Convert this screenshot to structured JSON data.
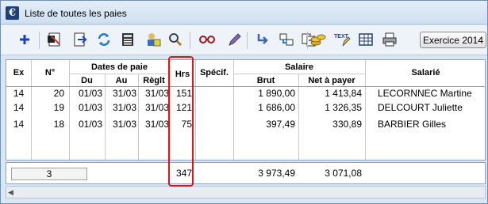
{
  "window": {
    "title": "Liste de toutes les paies"
  },
  "toolbar": {
    "exercice_label": "Exercice 2014",
    "icons": [
      "add-icon",
      "edit-doc-icon",
      "export-icon",
      "refresh-icon",
      "calculator-icon",
      "user-money-icon",
      "search-icon",
      "glasses-icon",
      "pencil-icon",
      "transfer-icon",
      "flow-icon",
      "coins-icon",
      "text-icon",
      "table-icon",
      "printer-icon"
    ],
    "text_icon_label": "TEXT"
  },
  "grid": {
    "headers": {
      "ex": "Ex",
      "num": "N°",
      "dates_group": "Dates de paie",
      "du": "Du",
      "au": "Au",
      "reglt": "Règlt",
      "hrs": "Hrs",
      "specif": "Spécif.",
      "salaire_group": "Salaire",
      "brut": "Brut",
      "net": "Net à payer",
      "salarie": "Salarié"
    },
    "rows": [
      {
        "ex": "14",
        "num": "20",
        "du": "01/03",
        "au": "31/03",
        "reglt": "31/03",
        "hrs": "151",
        "specif": "",
        "brut": "1 890,00",
        "net": "1 413,84",
        "salarie": "LECORNNEC Martine"
      },
      {
        "ex": "14",
        "num": "19",
        "du": "01/03",
        "au": "31/03",
        "reglt": "31/03",
        "hrs": "121",
        "specif": "",
        "brut": "1 686,00",
        "net": "1 326,35",
        "salarie": "DELCOURT Juliette"
      },
      {
        "ex": "14",
        "num": "18",
        "du": "01/03",
        "au": "31/03",
        "reglt": "31/03",
        "hrs": "75",
        "specif": "",
        "brut": "397,49",
        "net": "330,89",
        "salarie": "BARBIER Gilles"
      }
    ]
  },
  "totals": {
    "count": "3",
    "hrs": "347",
    "brut": "3 973,49",
    "net": "3 071,08"
  },
  "colors": {
    "highlight": "#e0141b",
    "accent": "#1f3f7a"
  }
}
